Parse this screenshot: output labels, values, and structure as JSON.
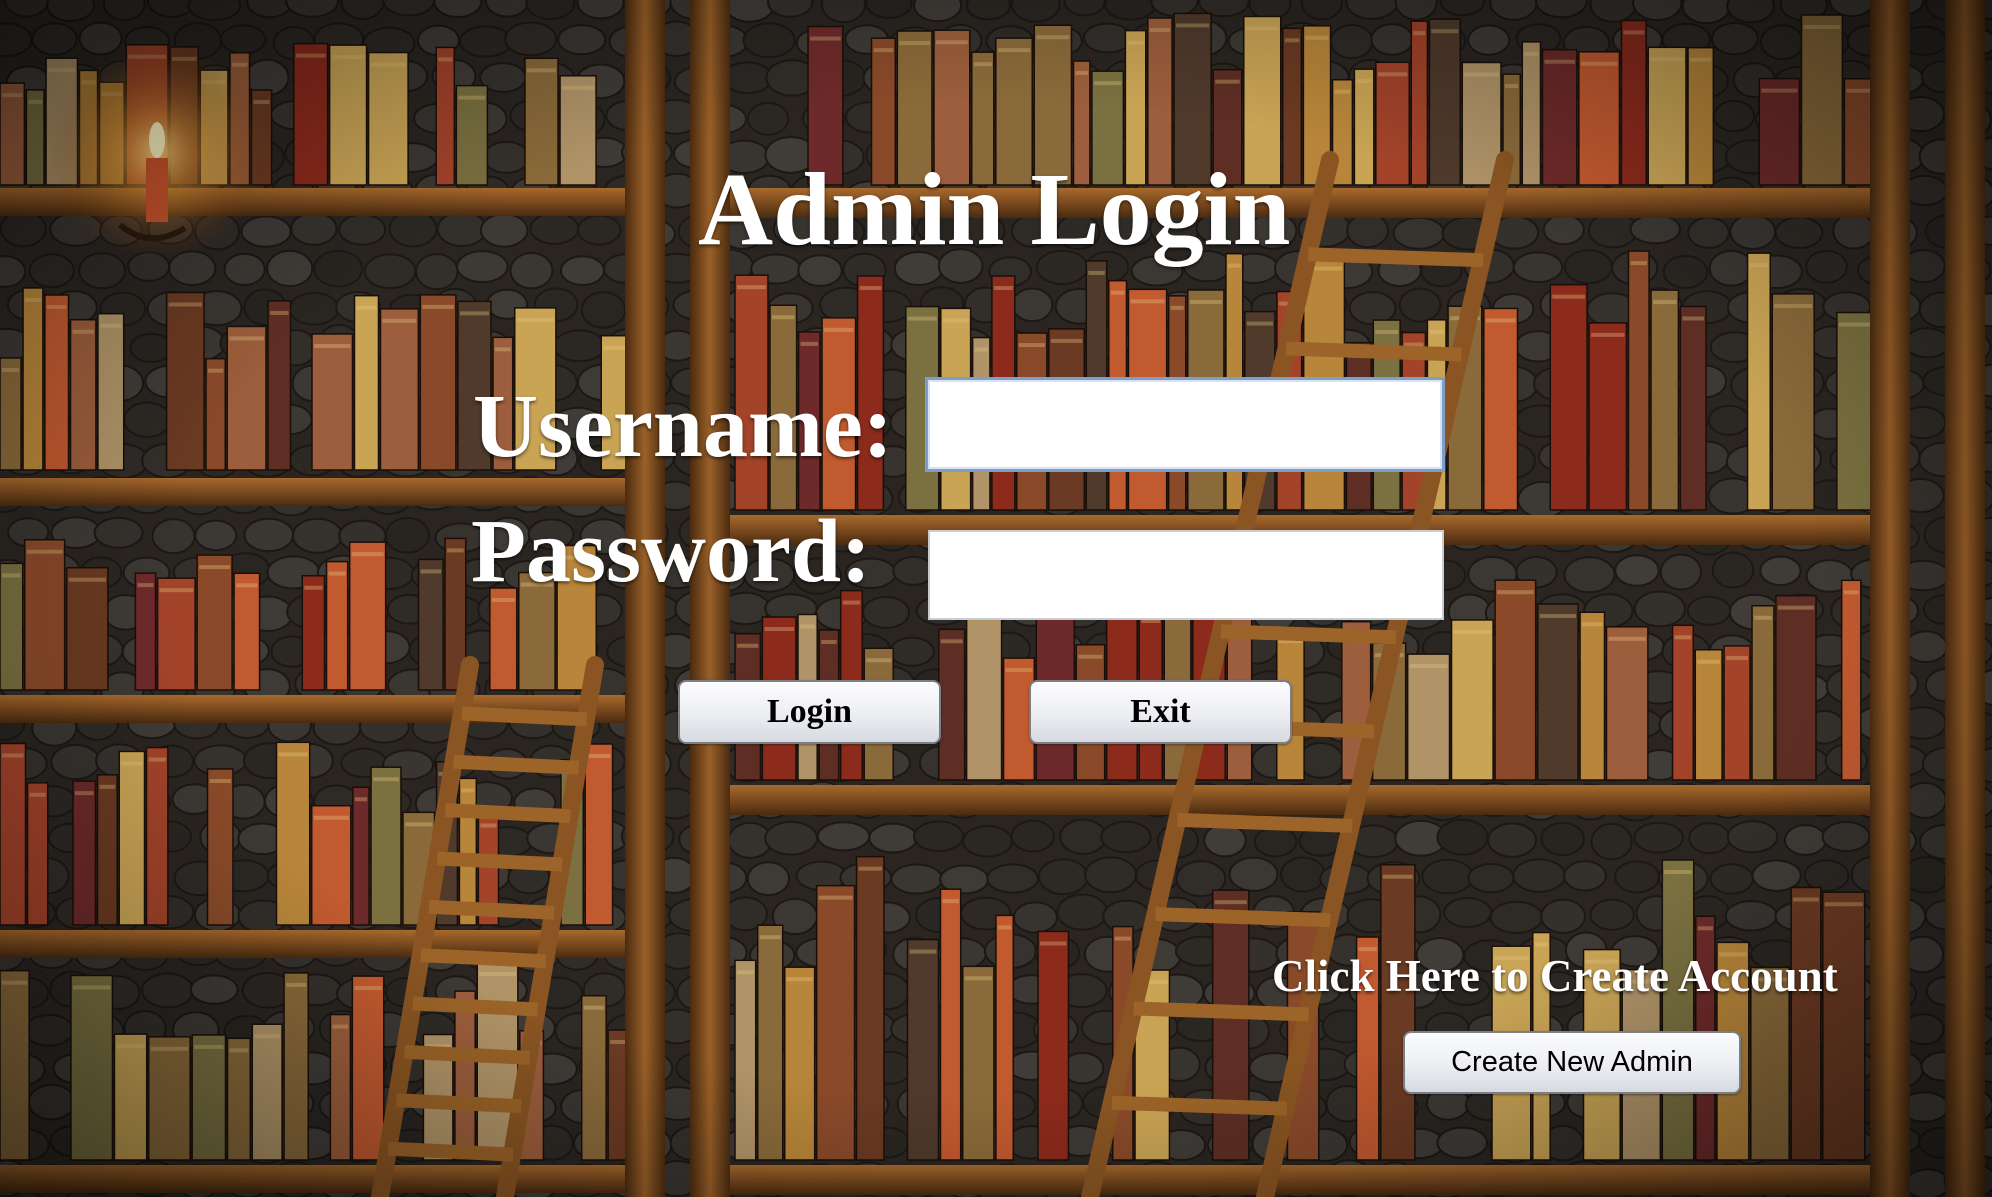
{
  "window": {
    "title": "Admin Login"
  },
  "form": {
    "username_label": "Username:",
    "username_value": "",
    "password_label": "Password:",
    "password_value": ""
  },
  "actions": {
    "login_label": "Login",
    "exit_label": "Exit"
  },
  "signup": {
    "prompt": "Click Here to Create Account",
    "button_label": "Create New Admin"
  },
  "colors": {
    "label_text": "#ffffff",
    "input_focus_border": "#7f9ec8",
    "background_wood": "#7a4a1e",
    "background_stone": "#2a2521"
  }
}
